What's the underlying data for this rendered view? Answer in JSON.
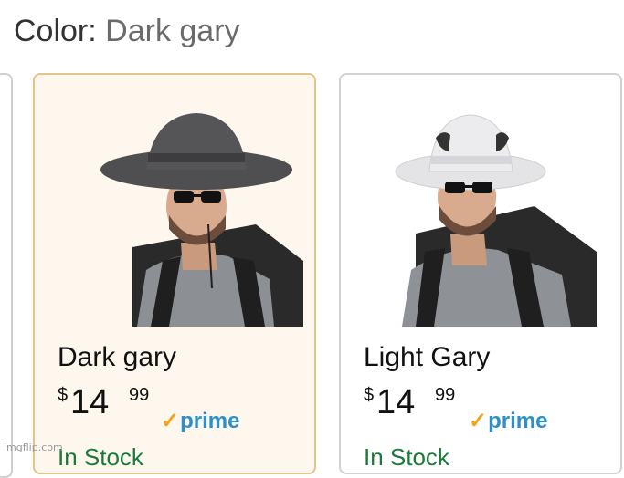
{
  "color_selector": {
    "label": "Color:",
    "value": "Dark gary"
  },
  "options": [
    {
      "name": "Dark gary",
      "price": {
        "currency": "$",
        "whole": "14",
        "fraction": "99"
      },
      "prime_check": "✓",
      "prime_label": "prime",
      "stock": "In Stock",
      "selected": true
    },
    {
      "name": "Light Gary",
      "price": {
        "currency": "$",
        "whole": "14",
        "fraction": "99"
      },
      "prime_check": "✓",
      "prime_label": "prime",
      "stock": "In Stock",
      "selected": false
    }
  ],
  "watermark": "imgflip.com",
  "colors": {
    "selected_bg": "#fdf7ee",
    "selected_border": "#e2c58a",
    "prime_blue": "#2d8fc7",
    "prime_check": "#f3a31a"
  }
}
